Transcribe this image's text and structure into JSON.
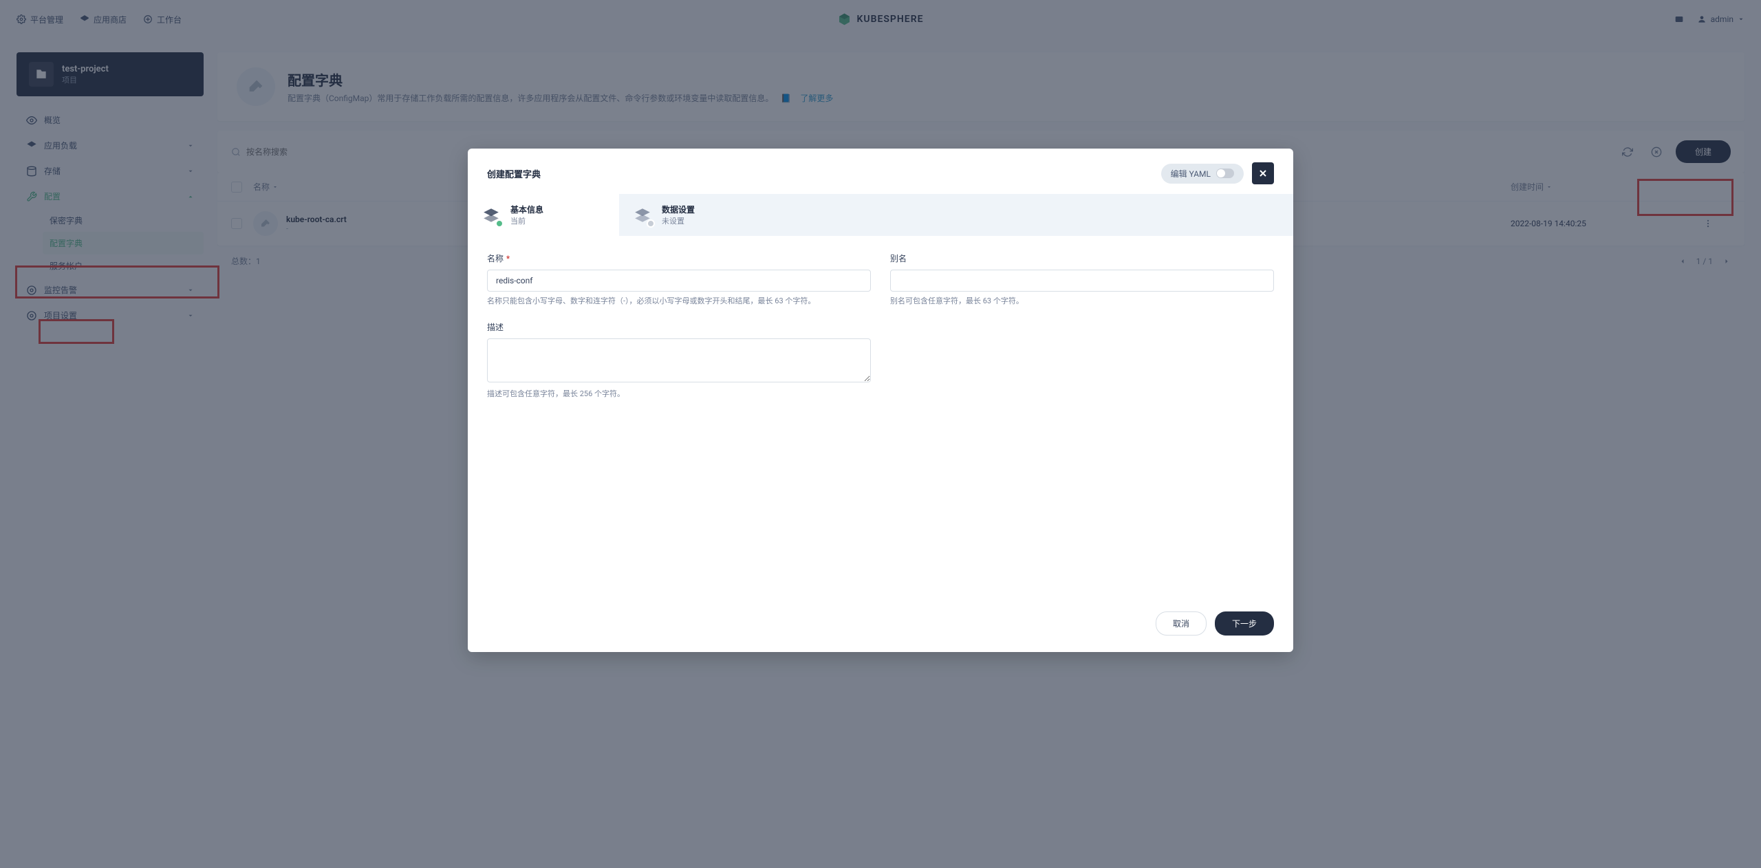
{
  "topnav": {
    "platform": "平台管理",
    "appstore": "应用商店",
    "workbench": "工作台",
    "brand": "KUBESPHERE",
    "user": "admin"
  },
  "project": {
    "name": "test-project",
    "label": "项目"
  },
  "sidebar": {
    "overview": "概览",
    "workloads": "应用负载",
    "storage": "存储",
    "configurations": "配置",
    "secrets": "保密字典",
    "configmaps": "配置字典",
    "serviceaccounts": "服务帐户",
    "monitoring": "监控告警",
    "settings": "项目设置"
  },
  "page": {
    "title": "配置字典",
    "desc": "配置字典（ConfigMap）常用于存储工作负载所需的配置信息，许多应用程序会从配置文件、命令行参数或环境变量中读取配置信息。",
    "more": "了解更多"
  },
  "toolbar": {
    "search_placeholder": "按名称搜索",
    "create": "创建"
  },
  "table": {
    "col_name": "名称",
    "col_time": "创建时间",
    "rows": [
      {
        "name": "kube-root-ca.crt",
        "sub": "-",
        "time": "2022-08-19 14:40:25"
      }
    ],
    "total_label": "总数：",
    "total": "1",
    "page": "1 / 1"
  },
  "modal": {
    "title": "创建配置字典",
    "yaml_label": "编辑 YAML",
    "tab1_title": "基本信息",
    "tab1_sub": "当前",
    "tab2_title": "数据设置",
    "tab2_sub": "未设置",
    "name_label": "名称",
    "name_value": "redis-conf",
    "name_hint": "名称只能包含小写字母、数字和连字符（-），必须以小写字母或数字开头和结尾，最长 63 个字符。",
    "alias_label": "别名",
    "alias_hint": "别名可包含任意字符，最长 63 个字符。",
    "desc_label": "描述",
    "desc_hint": "描述可包含任意字符，最长 256 个字符。",
    "cancel": "取消",
    "next": "下一步"
  }
}
